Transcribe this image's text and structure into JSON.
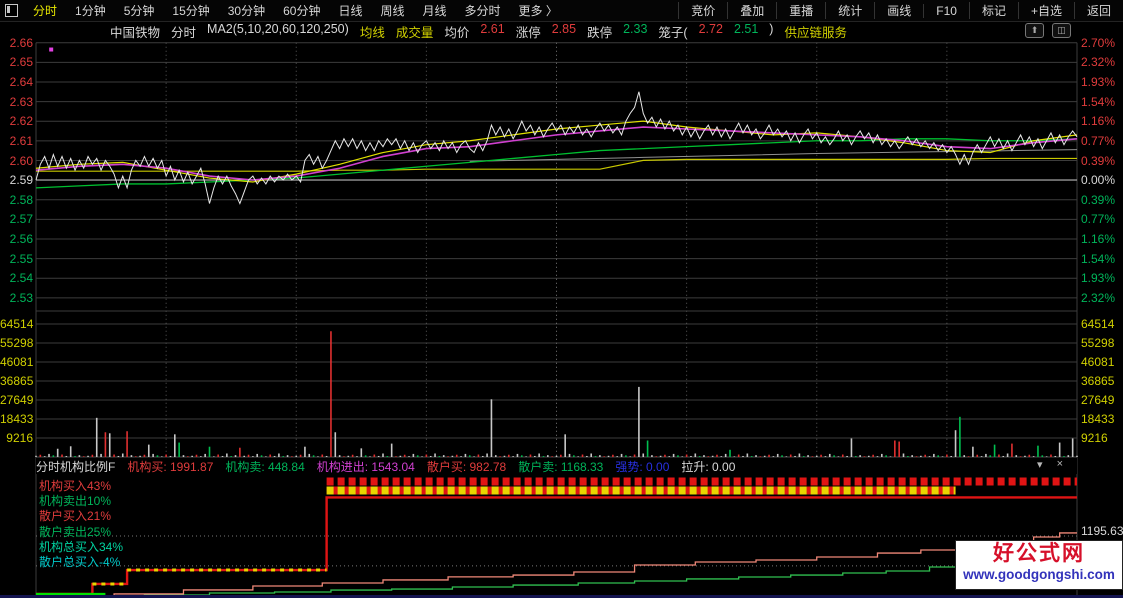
{
  "colors": {
    "red": "#e03c3c",
    "green": "#00b45a",
    "yellow": "#d0d000",
    "magenta": "#d040d0",
    "blue": "#2830e0",
    "white": "#d8d8d8",
    "gray": "#9a9a9a",
    "cyan": "#00c8c8",
    "spring": "#00d2a0"
  },
  "menubar": {
    "left": [
      {
        "label": "分时",
        "selected": true
      },
      {
        "label": "1分钟"
      },
      {
        "label": "5分钟"
      },
      {
        "label": "15分钟"
      },
      {
        "label": "30分钟"
      },
      {
        "label": "60分钟"
      },
      {
        "label": "日线"
      },
      {
        "label": "周线"
      },
      {
        "label": "月线"
      },
      {
        "label": "多分时"
      },
      {
        "label": "更多 〉"
      }
    ],
    "right": [
      {
        "label": "竞价"
      },
      {
        "label": "叠加"
      },
      {
        "label": "重播"
      },
      {
        "label": "统计"
      },
      {
        "label": "画线"
      },
      {
        "label": "F10"
      },
      {
        "label": "标记"
      },
      {
        "label": "+自选"
      },
      {
        "label": "返回"
      }
    ]
  },
  "info_bar": {
    "segments": [
      {
        "text": "中国铁物",
        "color": "white"
      },
      {
        "text": "分时",
        "color": "white"
      },
      {
        "text": "MA2(5,10,20,60,120,250)",
        "color": "white"
      },
      {
        "text": "均线",
        "color": "yellow"
      },
      {
        "text": "成交量",
        "color": "yellow"
      },
      {
        "text": "均价",
        "color": "white"
      },
      {
        "text": "2.61",
        "color": "red"
      },
      {
        "text": "涨停",
        "color": "white"
      },
      {
        "text": "2.85",
        "color": "red"
      },
      {
        "text": "跌停",
        "color": "white"
      },
      {
        "text": "2.33",
        "color": "green"
      },
      {
        "text": "笼子(",
        "color": "white"
      },
      {
        "text": "2.72",
        "color": "red"
      },
      {
        "text": "2.51",
        "color": "green"
      },
      {
        "text": ")",
        "color": "white"
      },
      {
        "text": "供应链服务",
        "color": "yellow"
      }
    ],
    "icons": [
      "expand-icon",
      "panel-icon"
    ]
  },
  "axes": {
    "price": [
      {
        "text": "2.66",
        "color": "red"
      },
      {
        "text": "2.65",
        "color": "red"
      },
      {
        "text": "2.64",
        "color": "red"
      },
      {
        "text": "2.63",
        "color": "red"
      },
      {
        "text": "2.62",
        "color": "red"
      },
      {
        "text": "2.61",
        "color": "red"
      },
      {
        "text": "2.60",
        "color": "red"
      },
      {
        "text": "2.59",
        "color": "white"
      },
      {
        "text": "2.58",
        "color": "green"
      },
      {
        "text": "2.57",
        "color": "green"
      },
      {
        "text": "2.56",
        "color": "green"
      },
      {
        "text": "2.55",
        "color": "green"
      },
      {
        "text": "2.54",
        "color": "green"
      },
      {
        "text": "2.53",
        "color": "green"
      }
    ],
    "pct": [
      {
        "text": "2.70%",
        "color": "red"
      },
      {
        "text": "2.32%",
        "color": "red"
      },
      {
        "text": "1.93%",
        "color": "red"
      },
      {
        "text": "1.54%",
        "color": "red"
      },
      {
        "text": "1.16%",
        "color": "red"
      },
      {
        "text": "0.77%",
        "color": "red"
      },
      {
        "text": "0.39%",
        "color": "red"
      },
      {
        "text": "0.00%",
        "color": "white"
      },
      {
        "text": "0.39%",
        "color": "green"
      },
      {
        "text": "0.77%",
        "color": "green"
      },
      {
        "text": "1.16%",
        "color": "green"
      },
      {
        "text": "1.54%",
        "color": "green"
      },
      {
        "text": "1.93%",
        "color": "green"
      },
      {
        "text": "2.32%",
        "color": "green"
      }
    ],
    "volume": [
      "64514",
      "55298",
      "46081",
      "36865",
      "27649",
      "18433",
      "9216"
    ]
  },
  "chart_data": {
    "type": "line",
    "title": "中国铁物 分时",
    "prev_close": 2.59,
    "minutes": 240,
    "price_line": [
      2.59,
      2.598,
      2.602,
      2.596,
      2.603,
      2.597,
      2.602,
      2.596,
      2.601,
      2.595,
      2.6,
      2.596,
      2.602,
      2.598,
      2.601,
      2.595,
      2.6,
      2.597,
      2.593,
      2.586,
      2.592,
      2.586,
      2.595,
      2.6,
      2.597,
      2.602,
      2.597,
      2.601,
      2.596,
      2.6,
      2.592,
      2.597,
      2.59,
      2.595,
      2.589,
      2.594,
      2.588,
      2.592,
      2.596,
      2.588,
      2.578,
      2.586,
      2.592,
      2.588,
      2.592,
      2.587,
      2.583,
      2.578,
      2.584,
      2.59,
      2.592,
      2.588,
      2.591,
      2.588,
      2.592,
      2.589,
      2.592,
      2.59,
      2.593,
      2.59,
      2.592,
      2.589,
      2.6,
      2.603,
      2.598,
      2.602,
      2.596,
      2.6,
      2.605,
      2.61,
      2.606,
      2.611,
      2.607,
      2.611,
      2.606,
      2.61,
      2.605,
      2.609,
      2.605,
      2.61,
      2.607,
      2.611,
      2.608,
      2.611,
      2.606,
      2.61,
      2.605,
      2.609,
      2.604,
      2.608,
      2.61,
      2.606,
      2.609,
      2.605,
      2.61,
      2.606,
      2.609,
      2.604,
      2.608,
      2.61,
      2.606,
      2.604,
      2.609,
      2.605,
      2.61,
      2.618,
      2.613,
      2.617,
      2.612,
      2.616,
      2.611,
      2.615,
      2.62,
      2.615,
      2.618,
      2.613,
      2.617,
      2.612,
      2.616,
      2.619,
      2.615,
      2.618,
      2.613,
      2.617,
      2.614,
      2.618,
      2.613,
      2.616,
      2.612,
      2.616,
      2.619,
      2.615,
      2.618,
      2.614,
      2.617,
      2.613,
      2.62,
      2.624,
      2.627,
      2.635,
      2.624,
      2.619,
      2.622,
      2.617,
      2.621,
      2.616,
      2.62,
      2.615,
      2.618,
      2.613,
      2.617,
      2.612,
      2.616,
      2.611,
      2.615,
      2.618,
      2.613,
      2.617,
      2.612,
      2.616,
      2.611,
      2.615,
      2.619,
      2.614,
      2.618,
      2.613,
      2.616,
      2.611,
      2.614,
      2.618,
      2.613,
      2.616,
      2.612,
      2.615,
      2.61,
      2.614,
      2.609,
      2.613,
      2.616,
      2.611,
      2.614,
      2.609,
      2.612,
      2.608,
      2.611,
      2.615,
      2.61,
      2.613,
      2.608,
      2.612,
      2.615,
      2.611,
      2.614,
      2.609,
      2.613,
      2.608,
      2.611,
      2.607,
      2.61,
      2.606,
      2.609,
      2.612,
      2.608,
      2.611,
      2.607,
      2.61,
      2.606,
      2.609,
      2.605,
      2.608,
      2.604,
      2.607,
      2.603,
      2.598,
      2.603,
      2.598,
      2.604,
      2.608,
      2.604,
      2.608,
      2.612,
      2.607,
      2.611,
      2.606,
      2.61,
      2.605,
      2.609,
      2.613,
      2.608,
      2.612,
      2.607,
      2.611,
      2.606,
      2.61,
      2.614,
      2.609,
      2.613,
      2.608,
      2.612,
      2.615,
      2.612
    ],
    "ma_step": 10,
    "avg_price_line": [
      2.595,
      2.597,
      2.598,
      2.596,
      2.592,
      2.59,
      2.592,
      2.596,
      2.602,
      2.606,
      2.607,
      2.61,
      2.613,
      2.615,
      2.617,
      2.616,
      2.615,
      2.614,
      2.613,
      2.612,
      2.61,
      2.607,
      2.606,
      2.609,
      2.611
    ],
    "ma_yellow": [
      2.596,
      2.598,
      2.599,
      2.595,
      2.591,
      2.589,
      2.593,
      2.598,
      2.604,
      2.608,
      2.61,
      2.613,
      2.616,
      2.618,
      2.62,
      2.617,
      2.615,
      2.613,
      2.614,
      2.612,
      2.609,
      2.605,
      2.604,
      2.61,
      2.613
    ],
    "ma_green": [
      2.586,
      2.587,
      2.588,
      2.588,
      2.589,
      2.59,
      2.591,
      2.593,
      2.595,
      2.597,
      2.599,
      2.601,
      2.603,
      2.605,
      2.606,
      2.607,
      2.608,
      2.609,
      2.61,
      2.61,
      2.611,
      2.611,
      2.61,
      2.61,
      2.611
    ],
    "ma_yellow_flat": [
      2.5945,
      2.5945,
      2.5945,
      2.5945,
      2.5945,
      2.5945,
      2.5945,
      2.595,
      2.595,
      2.5955,
      2.5955,
      2.5955,
      2.5955,
      2.5955,
      2.6,
      2.6005,
      2.6005,
      2.6005,
      2.6005,
      2.6005,
      2.6005,
      2.6005,
      2.601,
      2.601,
      2.601
    ],
    "ma_gray": {
      "x": [
        100,
        120,
        140,
        160,
        180,
        200,
        220,
        240
      ],
      "v": [
        2.5995,
        2.6005,
        2.6015,
        2.6025,
        2.6035,
        2.6042,
        2.6048,
        2.6055
      ]
    },
    "marker_dot": {
      "minute": 3.5,
      "price": 2.6565,
      "color": "#e040e0"
    },
    "volume": {
      "max_scale": 64514,
      "base_pattern": [
        600,
        1100,
        400,
        1500,
        800,
        300,
        1200,
        500,
        1700,
        450,
        900,
        350
      ],
      "base_colors": [
        "w",
        "r",
        "w",
        "w",
        "g",
        "w",
        "r",
        "w",
        "w",
        "g",
        "w",
        "r"
      ],
      "spikes": {
        "5": 4000,
        "8": 5200,
        "14": 19000,
        "16": 12000,
        "17": 11500,
        "21": 12500,
        "26": 6000,
        "32": 11000,
        "33": 7000,
        "40": 5000,
        "47": 4500,
        "62": 5000,
        "68": 61000,
        "69": 12000,
        "75": 4200,
        "82": 6500,
        "105": 28000,
        "122": 11000,
        "139": 34000,
        "141": 8000,
        "160": 3500,
        "188": 9000,
        "198": 8000,
        "199": 7500,
        "212": 13000,
        "213": 19500,
        "216": 5000,
        "221": 6000,
        "225": 6500,
        "231": 5500,
        "236": 7000,
        "239": 9000
      },
      "spike_colors": {
        "14": "w",
        "16": "r",
        "17": "w",
        "21": "r",
        "32": "w",
        "68": "r",
        "69": "w",
        "105": "w",
        "122": "w",
        "139": "w",
        "141": "g",
        "188": "w",
        "198": "r",
        "199": "r",
        "212": "w",
        "213": "g",
        "221": "g",
        "225": "r",
        "231": "g",
        "236": "w",
        "239": "w"
      }
    },
    "panel": {
      "red_steps": [
        [
          0,
          0.975
        ],
        [
          13,
          0.975
        ],
        [
          13,
          0.893
        ],
        [
          21,
          0.893
        ],
        [
          21,
          0.779
        ],
        [
          67,
          0.779
        ],
        [
          67,
          0.184
        ],
        [
          240,
          0.184
        ]
      ],
      "yellow_dash_segments": [
        [
          13,
          21,
          0.893
        ],
        [
          21,
          67,
          0.779
        ]
      ],
      "dash_rows": [
        {
          "from": 67,
          "to": 240,
          "frac": 0.053,
          "color": "#e01414",
          "underlay": false
        },
        {
          "from": 67,
          "to": 212,
          "frac": 0.127,
          "color": "#e8d400",
          "underlay": true
        }
      ],
      "pink_steps": [
        [
          0,
          0.992
        ],
        [
          18,
          0.992
        ],
        [
          18,
          0.975
        ],
        [
          34,
          0.975
        ],
        [
          34,
          0.942
        ],
        [
          50,
          0.942
        ],
        [
          50,
          0.91
        ],
        [
          66,
          0.91
        ],
        [
          66,
          0.885
        ],
        [
          80,
          0.885
        ],
        [
          80,
          0.86
        ],
        [
          95,
          0.86
        ],
        [
          95,
          0.835
        ],
        [
          110,
          0.835
        ],
        [
          110,
          0.82
        ],
        [
          124,
          0.82
        ],
        [
          124,
          0.795
        ],
        [
          138,
          0.795
        ],
        [
          138,
          0.738
        ],
        [
          152,
          0.738
        ],
        [
          152,
          0.713
        ],
        [
          166,
          0.713
        ],
        [
          166,
          0.697
        ],
        [
          180,
          0.697
        ],
        [
          180,
          0.672
        ],
        [
          194,
          0.672
        ],
        [
          194,
          0.64
        ],
        [
          204,
          0.64
        ],
        [
          204,
          0.615
        ],
        [
          214,
          0.615
        ],
        [
          214,
          0.582
        ],
        [
          222,
          0.582
        ],
        [
          222,
          0.548
        ],
        [
          230,
          0.548
        ],
        [
          230,
          0.508
        ],
        [
          236,
          0.508
        ],
        [
          236,
          0.475
        ],
        [
          240,
          0.475
        ]
      ],
      "green_steps": [
        [
          0,
          1.0
        ],
        [
          12,
          0.992
        ],
        [
          25,
          0.984
        ],
        [
          40,
          0.967
        ],
        [
          55,
          0.959
        ],
        [
          68,
          0.943
        ],
        [
          82,
          0.935
        ],
        [
          96,
          0.918
        ],
        [
          110,
          0.902
        ],
        [
          125,
          0.885
        ],
        [
          138,
          0.869
        ],
        [
          150,
          0.852
        ],
        [
          162,
          0.836
        ],
        [
          174,
          0.82
        ],
        [
          186,
          0.803
        ],
        [
          196,
          0.787
        ],
        [
          206,
          0.754
        ],
        [
          214,
          0.721
        ],
        [
          222,
          0.688
        ],
        [
          230,
          0.648
        ],
        [
          236,
          0.615
        ],
        [
          240,
          0.59
        ]
      ],
      "grid_fracs": [
        0.5,
        0.745
      ],
      "bright_green_segment": [
        0,
        16,
        0.978
      ]
    }
  },
  "bottom_panel": {
    "header": {
      "segments": [
        {
          "label": "分时机构比例F",
          "value": "",
          "color": "white"
        },
        {
          "label": "机构买:",
          "value": "1991.87",
          "color": "red"
        },
        {
          "label": "机构卖:",
          "value": "448.84",
          "color": "green"
        },
        {
          "label": "机构进出:",
          "value": "1543.04",
          "color": "magenta"
        },
        {
          "label": "散户买:",
          "value": "982.78",
          "color": "red"
        },
        {
          "label": "散户卖:",
          "value": "1168.33",
          "color": "green"
        },
        {
          "label": "强势:",
          "value": "0.00",
          "color": "blue"
        },
        {
          "label": "拉升:",
          "value": "0.00",
          "color": "white"
        }
      ],
      "collapse_icon": "▾",
      "close_icon": "×"
    },
    "left_labels": [
      {
        "text": "机构买入43%",
        "color": "red"
      },
      {
        "text": "机构卖出10%",
        "color": "green"
      },
      {
        "text": "散户买入21%",
        "color": "red"
      },
      {
        "text": "散户卖出25%",
        "color": "green"
      },
      {
        "text": "机构总买入34%",
        "color": "spring"
      },
      {
        "text": "散户总买入-4%",
        "color": "cyan"
      }
    ],
    "right_value": "1195.63"
  },
  "watermark": {
    "title": "好公式网",
    "url": "www.goodgongshi.com"
  }
}
